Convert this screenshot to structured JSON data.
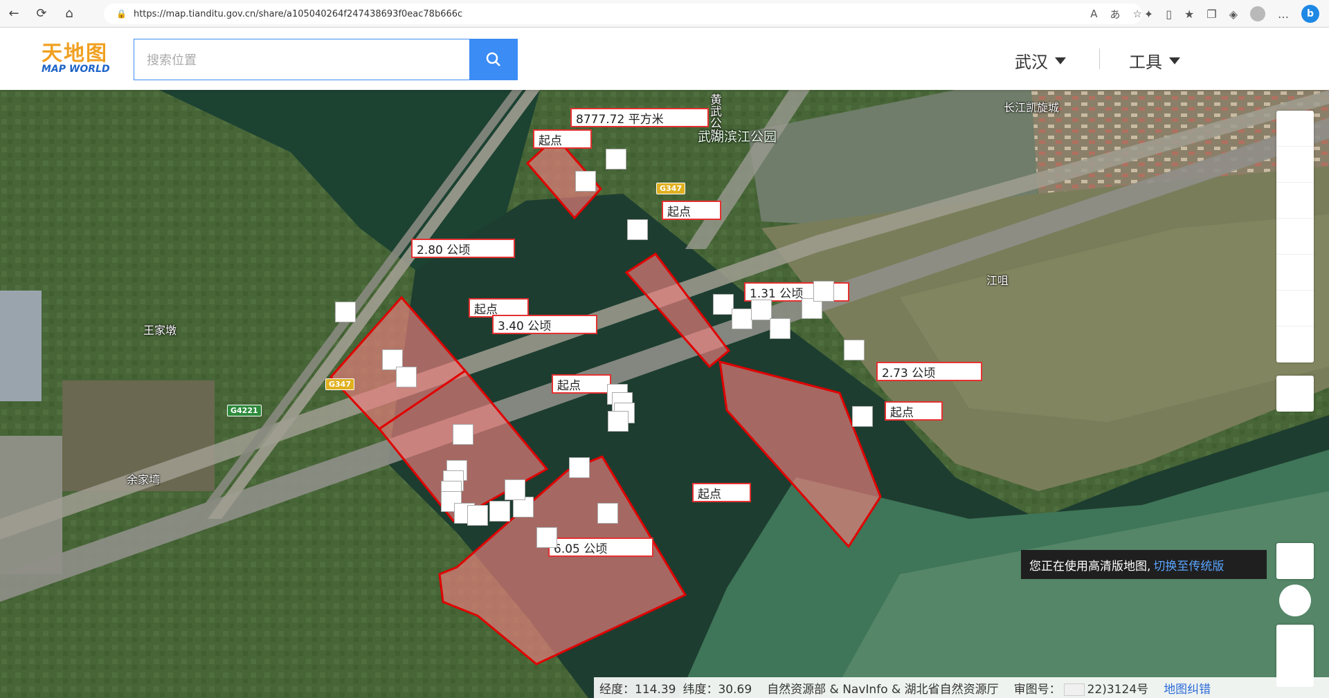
{
  "browser": {
    "url": "https://map.tianditu.gov.cn/share/a105040264f247438693f0eac78b666c"
  },
  "header": {
    "logo_cn": "天地图",
    "logo_en": "MAP WORLD",
    "search_placeholder": "搜索位置",
    "city": "武汉",
    "tools": "工具"
  },
  "map": {
    "places": {
      "huangwu_road": "黄武公路",
      "park": "武湖滨江公园",
      "kaixuan": "长江凯旋城",
      "wangjiadun": "王家墩",
      "yujiawan": "余家塆",
      "wangju": "江咀"
    },
    "road_badges": [
      "G347",
      "G347",
      "G4221"
    ],
    "measure_labels": {
      "area_sqm": "8777.72 平方米",
      "a280": "2.80 公顷",
      "a340": "3.40 公顷",
      "a131": "1.31 公顷",
      "a273": "2.73 公顷",
      "a605": "6.05 公顷"
    },
    "start_label": "起点"
  },
  "tip": {
    "text": "您正在使用高清版地图,",
    "link": "切换至传统版"
  },
  "status": {
    "lng": "经度：114.39",
    "lat": "纬度：30.69",
    "attribution": "自然资源部 & NavInfo & 湖北省自然资源厅",
    "approval_prefix": "审图号：",
    "approval_suffix": "22)3124号",
    "error_link": "地图纠错"
  }
}
